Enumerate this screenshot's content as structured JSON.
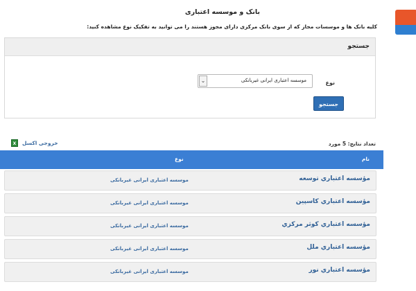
{
  "page": {
    "title": "بانک و موسسه اعتباری",
    "description": "کلیه بانک ها و موسسات مجاز که از سوی بانک مرکزی دارای مجوز هستند را می توانید به تفکیک نوع مشاهده کنید:"
  },
  "search": {
    "header": "جستجو",
    "type_label": "نوع",
    "type_selected": "موسسه اعتباری ایرانی غیربانکی",
    "button_label": "جستجو"
  },
  "results": {
    "count_label": "تعداد نتایج: 5 مورد",
    "export_label": "خروجی اکسل",
    "export_icon": "excel-icon",
    "columns": {
      "name": "نام",
      "type": "نوع"
    },
    "rows": [
      {
        "name": "مؤسسه اعتباري توسعه",
        "type": "موسسه اعتباری ایرانی غیربانکی"
      },
      {
        "name": "مؤسسه اعتباري کاسپین",
        "type": "موسسه اعتباری ایرانی غیربانکی"
      },
      {
        "name": "مؤسسه اعتباري كوثر مركزي",
        "type": "موسسه اعتباری ایرانی غیربانکی"
      },
      {
        "name": "مؤسسه اعتباري ملل",
        "type": "موسسه اعتباری ایرانی غیربانکی"
      },
      {
        "name": "مؤسسه اعتباري نور",
        "type": "موسسه اعتباری ایرانی غیربانکی"
      }
    ]
  },
  "colors": {
    "header_blue": "#3b7fd4",
    "button_blue": "#2f6fb5",
    "link_blue": "#2f5f95",
    "widget_orange": "#e8562a",
    "widget_blue": "#2f7fd0"
  }
}
